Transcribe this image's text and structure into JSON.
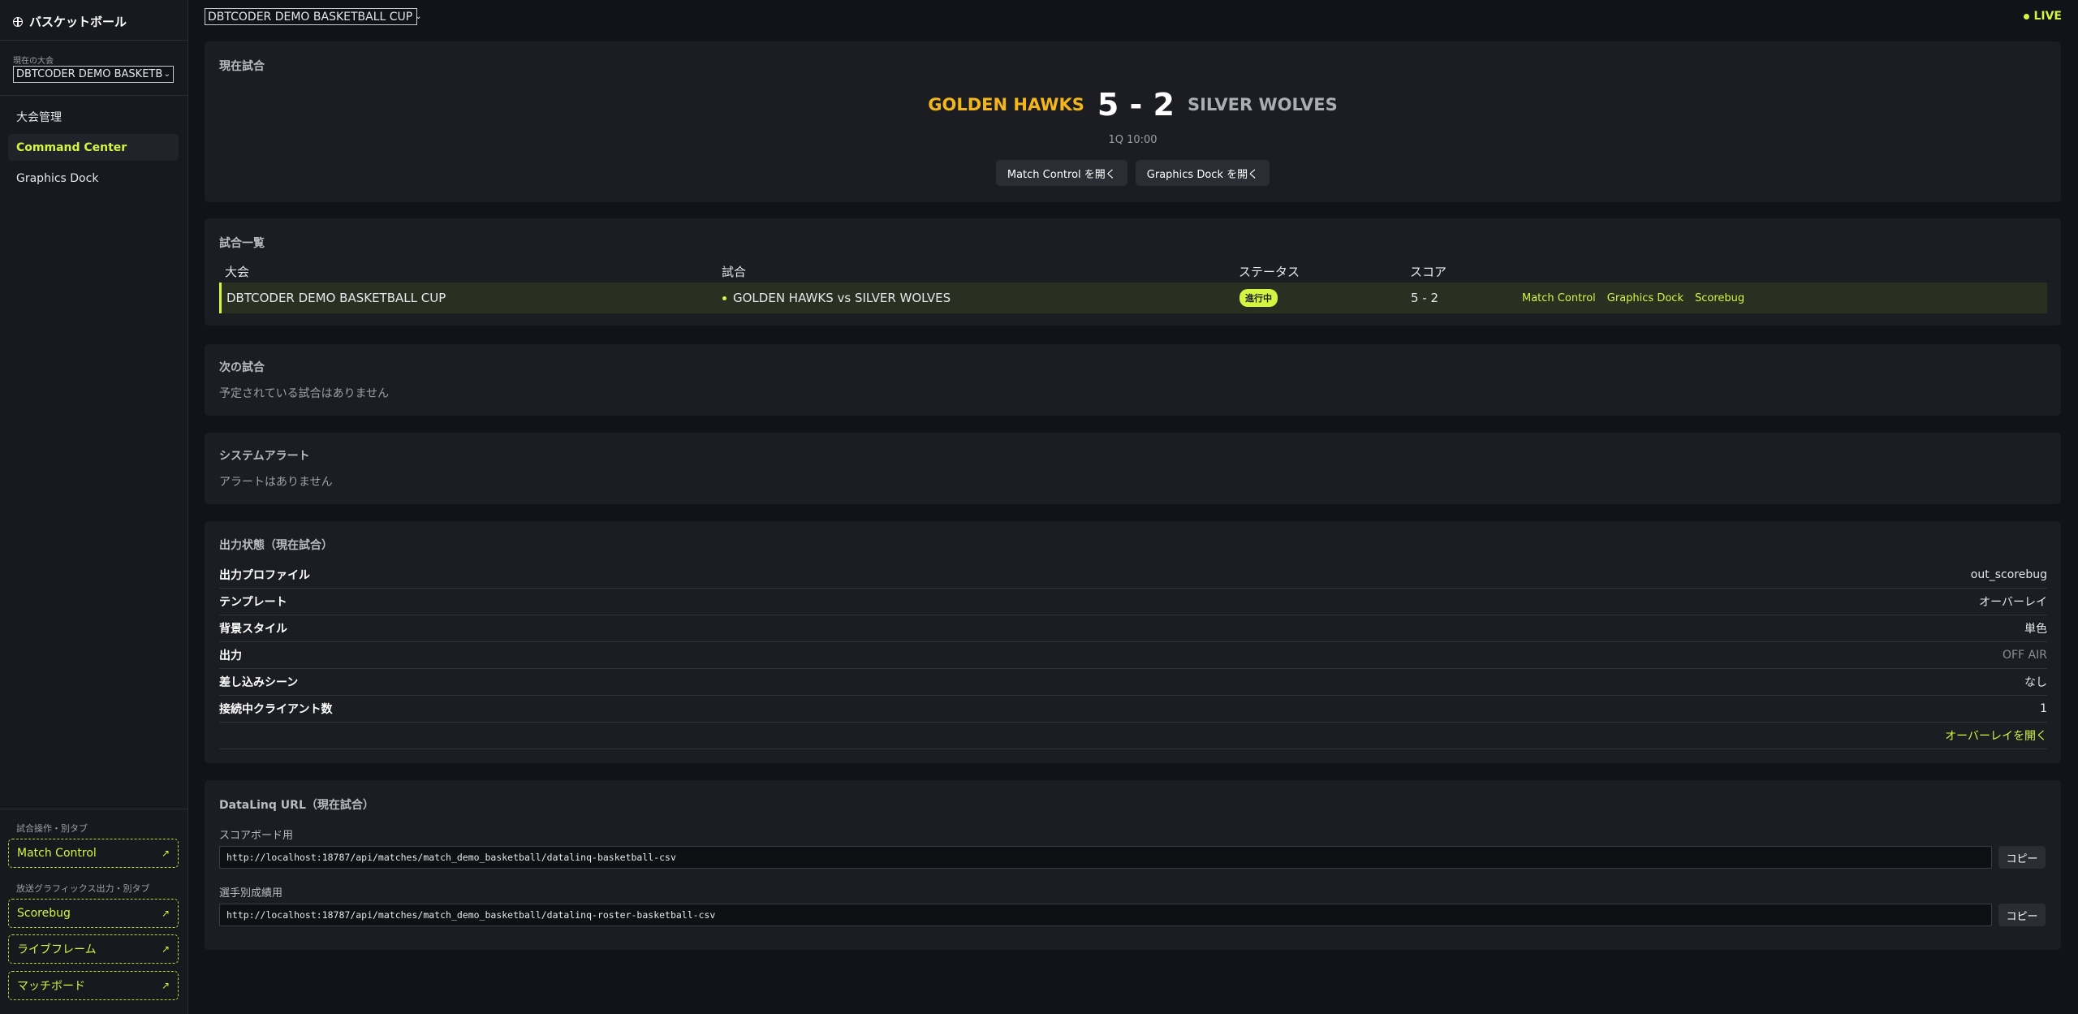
{
  "sidebar": {
    "brand": "バスケットボール",
    "current_tournament_label": "現在の大会",
    "current_tournament_value": "DBTCODER DEMO BASKETBALL CUP",
    "nav": [
      {
        "label": "大会管理"
      },
      {
        "label": "Command Center"
      },
      {
        "label": "Graphics Dock"
      }
    ],
    "match_ops_label": "試合操作・別タブ",
    "match_control_link": "Match Control",
    "broadcast_label": "放送グラフィックス出力・別タブ",
    "broadcast_links": [
      {
        "label": "Scorebug"
      },
      {
        "label": "ライブフレーム"
      },
      {
        "label": "マッチボード"
      }
    ],
    "external_glyph": "↗"
  },
  "header": {
    "tournament_select": "DBTCODER DEMO BASKETBALL CUP",
    "live_label": "LIVE"
  },
  "current_match": {
    "title": "現在試合",
    "home_team": "GOLDEN HAWKS",
    "score": "5 - 2",
    "away_team": "SILVER WOLVES",
    "period_clock": "1Q 10:00",
    "open_match_control": "Match Control を開く",
    "open_graphics_dock": "Graphics Dock を開く"
  },
  "match_list": {
    "title": "試合一覧",
    "headers": {
      "tournament": "大会",
      "match": "試合",
      "status": "ステータス",
      "score": "スコア"
    },
    "rows": [
      {
        "tournament": "DBTCODER DEMO BASKETBALL CUP",
        "match": "GOLDEN HAWKS vs SILVER WOLVES",
        "status": "進行中",
        "score": "5 - 2",
        "links": [
          "Match Control",
          "Graphics Dock",
          "Scorebug"
        ]
      }
    ]
  },
  "next_match": {
    "title": "次の試合",
    "empty": "予定されている試合はありません"
  },
  "alerts": {
    "title": "システムアラート",
    "empty": "アラートはありません"
  },
  "output_status": {
    "title": "出力状態（現在試合）",
    "rows": [
      {
        "key": "出力プロファイル",
        "value": "out_scorebug"
      },
      {
        "key": "テンプレート",
        "value": "オーバーレイ"
      },
      {
        "key": "背景スタイル",
        "value": "単色"
      },
      {
        "key": "出力",
        "value": "OFF AIR"
      },
      {
        "key": "差し込みシーン",
        "value": "なし"
      },
      {
        "key": "接続中クライアント数",
        "value": "1"
      }
    ],
    "open_overlay": "オーバーレイを開く"
  },
  "datalinq": {
    "title": "DataLinq URL（現在試合）",
    "scoreboard_label": "スコアボード用",
    "scoreboard_url": "http://localhost:18787/api/matches/match_demo_basketball/datalinq-basketball-csv",
    "roster_label": "選手別成績用",
    "roster_url": "http://localhost:18787/api/matches/match_demo_basketball/datalinq-roster-basketball-csv",
    "copy_label": "コピー"
  },
  "colors": {
    "accent": "#d4f542",
    "home_team": "#f2b51c",
    "background": "#111318",
    "card": "#1b1d22"
  }
}
